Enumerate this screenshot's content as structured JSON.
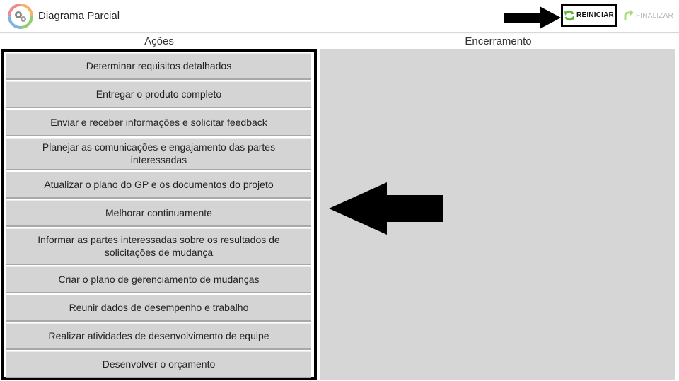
{
  "app": {
    "title": "Diagrama Parcial",
    "logo_icon": "gears-cycle-icon"
  },
  "toolbar": {
    "reiniciar_label": "REINICIAR",
    "reiniciar_icon": "refresh-icon",
    "finalizar_label": "FINALIZAR",
    "finalizar_icon": "redo-arrow-icon"
  },
  "columns": {
    "acoes_title": "Ações",
    "encerramento_title": "Encerramento"
  },
  "actions": [
    "Determinar requisitos detalhados",
    "Entregar o produto completo",
    "Enviar e receber informações e solicitar feedback",
    "Planejar as comunicações e engajamento das partes interessadas",
    "Atualizar o plano do GP e os documentos do projeto",
    "Melhorar continuamente",
    "Informar as partes interessadas sobre os resultados de solicitações de mudança",
    "Criar o plano de gerenciamento de mudanças",
    "Reunir dados de desempenho e trabalho",
    "Realizar atividades de desenvolvimento de equipe",
    "Desenvolver o orçamento"
  ],
  "colors": {
    "card_bg": "#d4d4d4",
    "zone_bg": "#d6d6d6",
    "accent_green": "#5cb832",
    "finalizar_green": "#a8dc7c"
  }
}
